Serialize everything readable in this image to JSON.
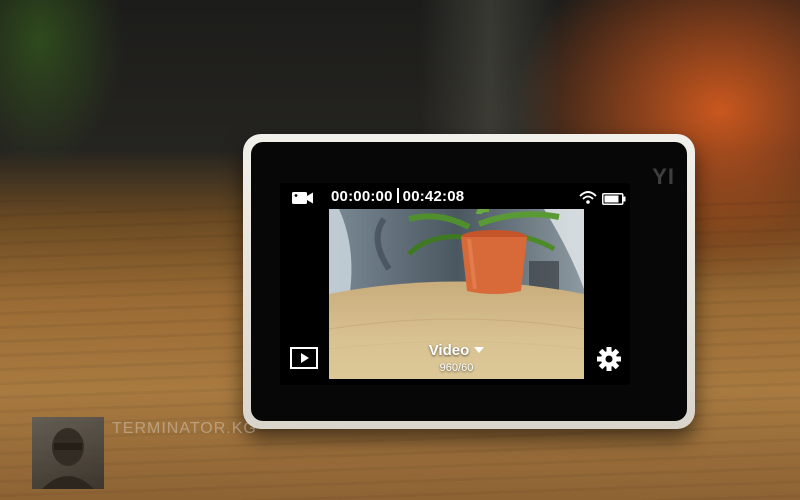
{
  "camera": {
    "brand": "YI",
    "screen": {
      "mode_icon": "video-camera-icon",
      "elapsed_time": "00:00:00",
      "remaining_time": "00:42:08",
      "wifi_icon": "wifi-icon",
      "battery_icon": "battery-icon",
      "battery_level": 0.85,
      "mode_label": "Video",
      "resolution": "960/60",
      "playback_icon": "playback-icon",
      "settings_icon": "gear-icon"
    }
  },
  "watermark": {
    "text": "TERMINATOR.KG",
    "icon": "avatar-icon"
  },
  "colors": {
    "camera_body": "#ece9e2",
    "bezel": "#070707",
    "hud_text": "#ffffff",
    "pot": "#d86a3a",
    "table": "#d8c090"
  }
}
